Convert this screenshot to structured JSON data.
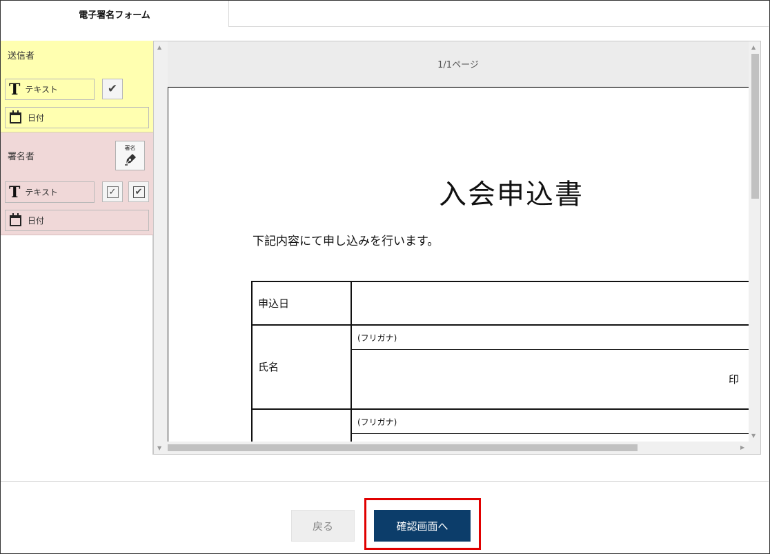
{
  "tab": {
    "label": "電子署名フォーム"
  },
  "sender": {
    "title": "送信者",
    "text_field_label": "テキスト",
    "date_field_label": "日付"
  },
  "signer": {
    "title": "署名者",
    "signature_button_label": "署名",
    "text_field_label": "テキスト",
    "date_field_label": "日付"
  },
  "viewer": {
    "page_indicator": "1/1ページ"
  },
  "document": {
    "title": "入会申込書",
    "intro": "下記内容にて申し込みを行います。",
    "rows": {
      "date_label": "申込日",
      "name_label": "氏名",
      "furigana_1": "(フリガナ)",
      "seal": "印",
      "furigana_2": "(フリガナ)"
    }
  },
  "footer": {
    "back_label": "戻る",
    "confirm_label": "確認画面へ",
    "highlight_color": "#e00000",
    "confirm_color": "#0c3d6a"
  }
}
